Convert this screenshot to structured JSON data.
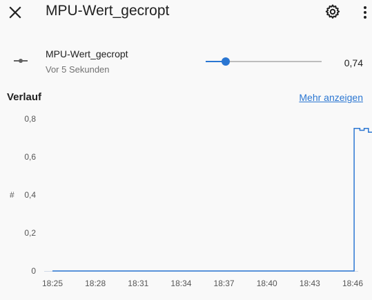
{
  "header": {
    "title": "MPU-Wert_gecropt",
    "close_icon": "close-icon",
    "settings_icon": "gear-icon",
    "menu_icon": "more-vertical-icon"
  },
  "entity": {
    "name": "MPU-Wert_gecropt",
    "last_changed": "Vor 5 Sekunden",
    "value_label": "0,74",
    "icon": "number-slider-icon",
    "slider_fraction": 0.17,
    "accent_color": "#2a76d2"
  },
  "history": {
    "title": "Verlauf",
    "show_more_label": "Mehr anzeigen"
  },
  "chart_data": {
    "type": "line",
    "ylabel_icon": "hash-icon",
    "yticks": [
      "0",
      "0,2",
      "0,4",
      "0,6",
      "0,8"
    ],
    "xticks": [
      "18:25",
      "18:28",
      "18:31",
      "18:34",
      "18:37",
      "18:40",
      "18:43",
      "18:46"
    ],
    "ylim": [
      0,
      0.8
    ],
    "x_minutes_from_1825": [
      0,
      21.1,
      21.1,
      21.5,
      21.5,
      21.8,
      21.8,
      22.1,
      22.1,
      22.4,
      22.4,
      22.7,
      22.7,
      23.0,
      23.0,
      23.3,
      23.3,
      23.6,
      23.6,
      24.0,
      24.0,
      24.3,
      24.3,
      24.6
    ],
    "values": [
      0,
      0,
      0.75,
      0.75,
      0.74,
      0.74,
      0.75,
      0.75,
      0.73,
      0.73,
      0.75,
      0.75,
      0.72,
      0.72,
      0.74,
      0.74,
      0.72,
      0.72,
      0.73,
      0.73,
      0.75,
      0.75,
      0.74,
      0.74
    ],
    "series_color": "#2a76d2",
    "grid": false
  }
}
